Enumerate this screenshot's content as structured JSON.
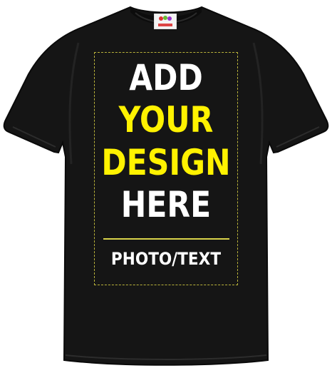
{
  "design_text": {
    "line1": "ADD",
    "line2": "YOUR",
    "line3": "DESIGN",
    "line4": "HERE",
    "line5": "PHOTO/TEXT"
  },
  "colors": {
    "shirt": "#121212",
    "highlight": "#fff200",
    "white_text": "#ffffff",
    "guide": "#b9b23a"
  },
  "icons": {
    "shirt": "tshirt-icon",
    "label": "brand-label-icon"
  }
}
